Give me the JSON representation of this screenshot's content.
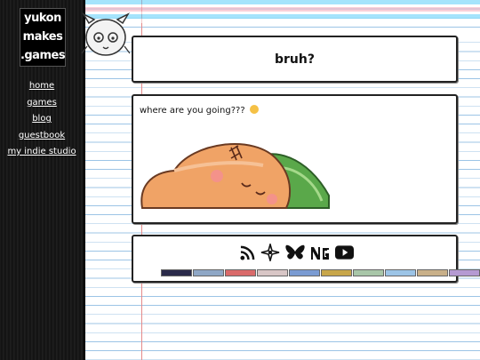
{
  "logo": {
    "line1": "yukon",
    "line2": "makes",
    ".line3": ".games",
    "line3": ".games"
  },
  "nav": [
    {
      "label": "home"
    },
    {
      "label": "games"
    },
    {
      "label": "blog"
    },
    {
      "label": "guestbook"
    },
    {
      "label": "my indie studio"
    }
  ],
  "main": {
    "title": "bruh?",
    "message": "where are you going???"
  },
  "colors": {
    "sidebar": "#161616",
    "margin_line": "#e48a8a",
    "ruled_line": "#9cc4e6",
    "card_border": "#222222"
  },
  "social_icons": [
    "rss-icon",
    "sparkle-icon",
    "bluesky-icon",
    "newgrounds-icon",
    "youtube-icon"
  ],
  "button_badges": [
    {
      "name": "badge-1",
      "color": "#2a2a4a"
    },
    {
      "name": "badge-2",
      "color": "#8fa7c6"
    },
    {
      "name": "badge-3",
      "color": "#d96a6a"
    },
    {
      "name": "badge-4",
      "color": "#d8c6c6"
    },
    {
      "name": "badge-5",
      "color": "#7a9bd2"
    },
    {
      "name": "badge-6",
      "color": "#c8a64a"
    },
    {
      "name": "badge-7",
      "color": "#a8c6a8"
    },
    {
      "name": "badge-8",
      "color": "#9cc4e6"
    },
    {
      "name": "badge-9",
      "color": "#c9b089"
    },
    {
      "name": "badge-10",
      "color": "#b59ad2"
    }
  ]
}
